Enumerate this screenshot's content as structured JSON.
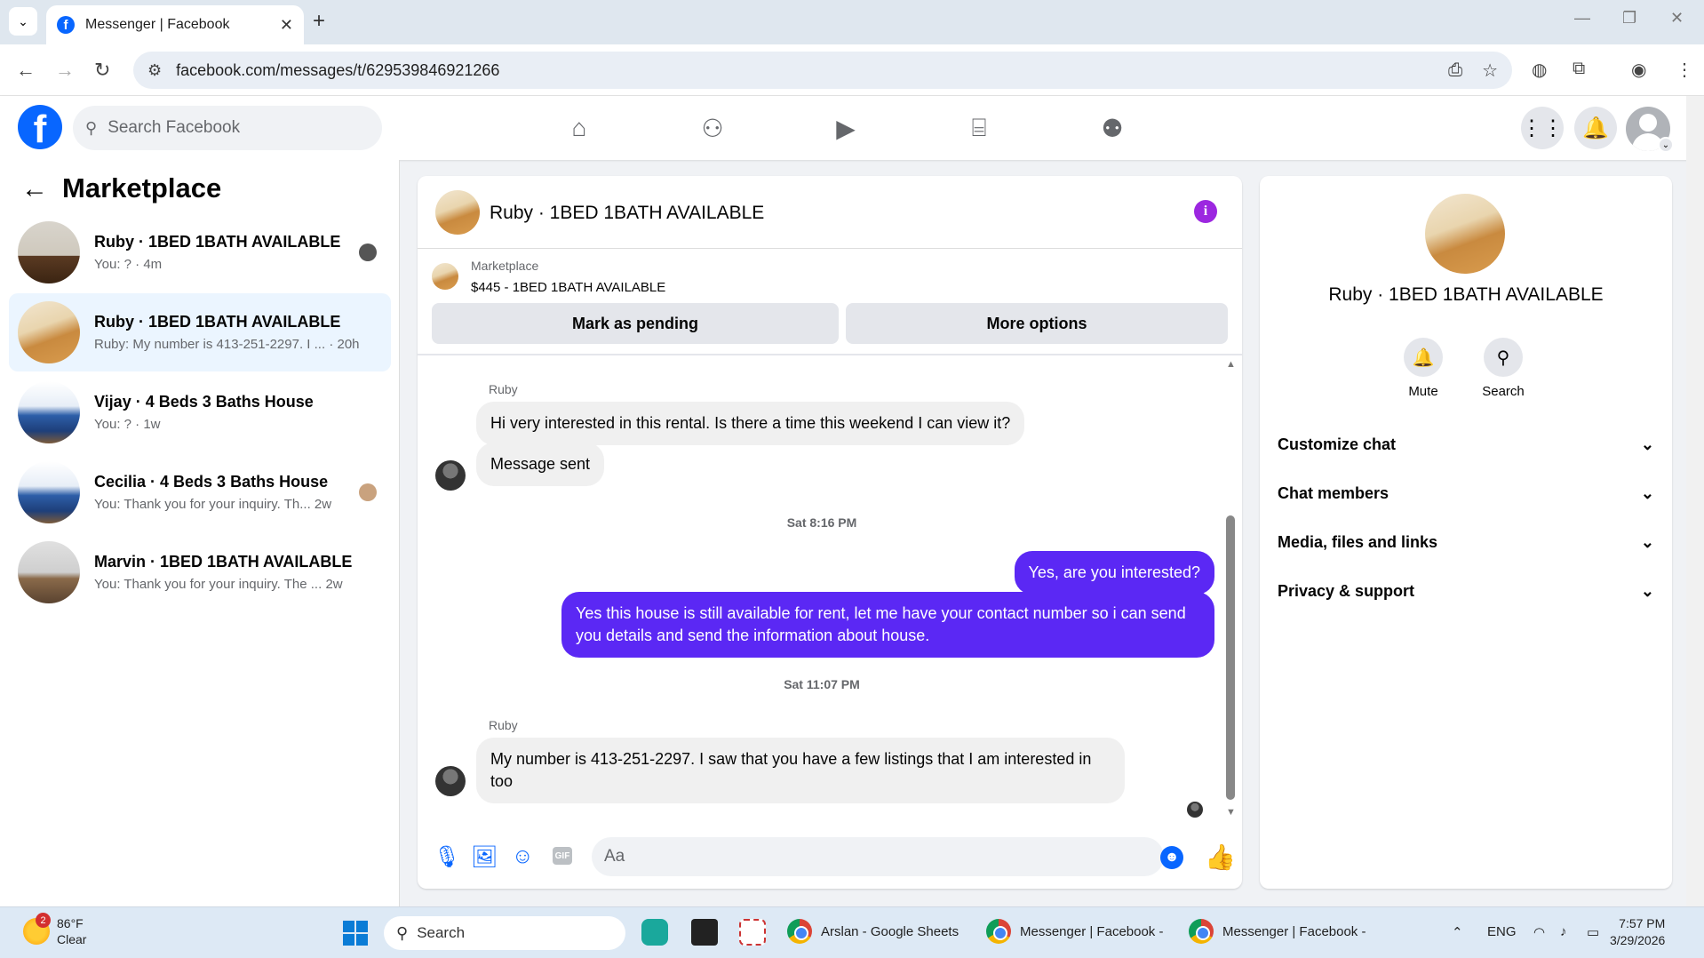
{
  "browser": {
    "tab_title": "Messenger | Facebook",
    "url": "facebook.com/messages/t/629539846921266"
  },
  "fb": {
    "search_placeholder": "Search Facebook"
  },
  "sidebar": {
    "title": "Marketplace",
    "conversations": [
      {
        "name": "Ruby · 1BED 1BATH AVAILABLE",
        "preview": "You: ? · 4m",
        "time": ""
      },
      {
        "name": "Ruby · 1BED 1BATH AVAILABLE",
        "preview": "Ruby: My number is 413-251-2297. I ...",
        "time": "· 20h"
      },
      {
        "name": "Vijay · 4 Beds 3 Baths House",
        "preview": "You: ? · 1w",
        "time": ""
      },
      {
        "name": "Cecilia · 4 Beds 3 Baths House",
        "preview": "You: Thank you for your inquiry. Th...",
        "time": "2w"
      },
      {
        "name": "Marvin · 1BED 1BATH AVAILABLE",
        "preview": "You: Thank you for your inquiry. The ...",
        "time": "2w"
      }
    ]
  },
  "chat": {
    "title": "Ruby · 1BED 1BATH AVAILABLE",
    "marketplace_label": "Marketplace",
    "listing": "$445 - 1BED 1BATH AVAILABLE",
    "mark_pending": "Mark as pending",
    "more_options": "More options",
    "messages": [
      {
        "sender": "Ruby",
        "text": "Hi very interested in this rental. Is there a time this weekend I can view it?"
      },
      {
        "text": "Message sent"
      },
      {
        "timestamp": "Sat 8:16 PM"
      },
      {
        "text": "Yes, are you interested?"
      },
      {
        "text": "Yes this house is still available for rent, let me have your contact number so i can send you details and send the information about house."
      },
      {
        "timestamp": "Sat 11:07 PM"
      },
      {
        "sender": "Ruby",
        "text": "My number is 413-251-2297. I saw that you have a few listings that I am interested in too"
      }
    ],
    "composer_placeholder": "Aa",
    "gif_label": "GIF"
  },
  "info_panel": {
    "name": "Ruby · 1BED 1BATH AVAILABLE",
    "mute": "Mute",
    "search": "Search",
    "sections": [
      "Customize chat",
      "Chat members",
      "Media, files and links",
      "Privacy & support"
    ]
  },
  "taskbar": {
    "weather_temp": "86°F",
    "weather_desc": "Clear",
    "weather_badge": "2",
    "search": "Search",
    "apps": [
      "Arslan - Google Sheets",
      "Messenger | Facebook -",
      "Messenger | Facebook -"
    ],
    "lang": "ENG",
    "time": "7:57 PM",
    "date": "3/29/2026"
  }
}
